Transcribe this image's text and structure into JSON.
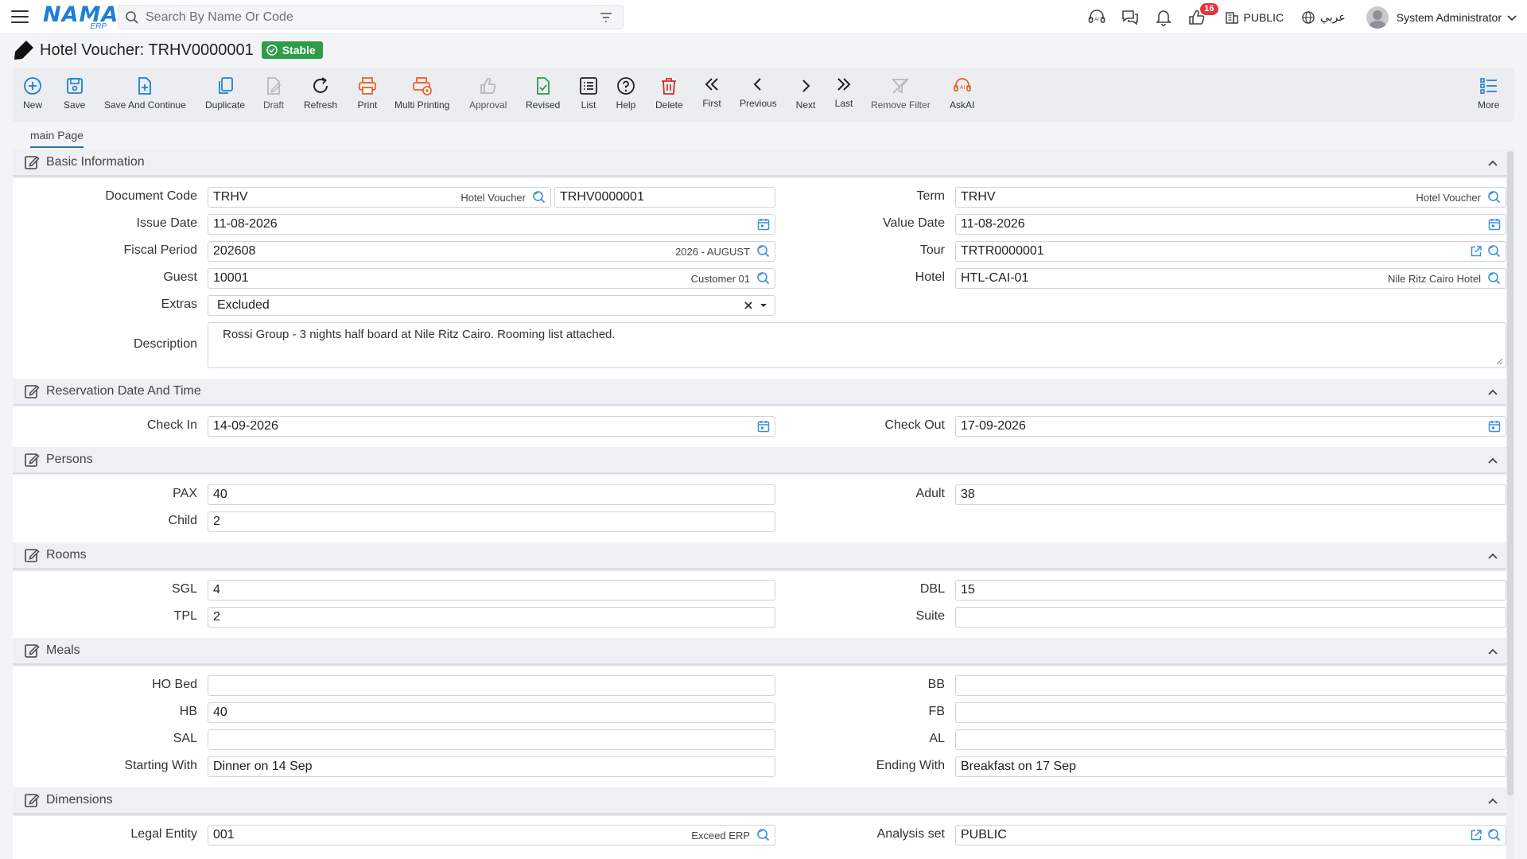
{
  "app": {
    "logo": "NAMA",
    "logo_sub": "ERP",
    "search_placeholder": "Search By Name Or Code",
    "notifications_count": "16",
    "branch": "PUBLIC",
    "language": "عربي",
    "user": "System Administrator"
  },
  "page": {
    "title": "Hotel Voucher: TRHV0000001",
    "status": "Stable"
  },
  "toolbar": {
    "new": "New",
    "save": "Save",
    "save_continue": "Save And Continue",
    "duplicate": "Duplicate",
    "draft": "Draft",
    "refresh": "Refresh",
    "print": "Print",
    "multi_printing": "Multi Printing",
    "approval": "Approval",
    "revised": "Revised",
    "list": "List",
    "help": "Help",
    "delete": "Delete",
    "first": "First",
    "previous": "Previous",
    "next": "Next",
    "last": "Last",
    "remove_filter": "Remove Filter",
    "askai": "AskAI",
    "more": "More"
  },
  "tabs": {
    "main": "main Page"
  },
  "colors": {
    "accent": "#1f7ed6",
    "success": "#2e9c49",
    "danger": "#e5343d",
    "orange": "#e8632b"
  },
  "sections": {
    "basic": {
      "title": "Basic Information",
      "document_code": {
        "label": "Document Code",
        "value": "TRHV",
        "sub": "Hotel Voucher",
        "code": "TRHV0000001"
      },
      "term": {
        "label": "Term",
        "value": "TRHV",
        "sub": "Hotel Voucher"
      },
      "issue_date": {
        "label": "Issue Date",
        "value": "11-08-2026"
      },
      "value_date": {
        "label": "Value Date",
        "value": "11-08-2026"
      },
      "fiscal_period": {
        "label": "Fiscal Period",
        "value": "202608",
        "sub": "2026 - AUGUST"
      },
      "tour": {
        "label": "Tour",
        "value": "TRTR0000001"
      },
      "guest": {
        "label": "Guest",
        "value": "10001",
        "sub": "Customer 01"
      },
      "hotel": {
        "label": "Hotel",
        "value": "HTL-CAI-01",
        "sub": "Nile Ritz Cairo Hotel"
      },
      "extras": {
        "label": "Extras",
        "value": "Excluded"
      },
      "description": {
        "label": "Description",
        "value": "Rossi Group - 3 nights half board at Nile Ritz Cairo. Rooming list attached."
      }
    },
    "reservation": {
      "title": "Reservation Date And Time",
      "check_in": {
        "label": "Check In",
        "value": "14-09-2026"
      },
      "check_out": {
        "label": "Check Out",
        "value": "17-09-2026"
      }
    },
    "persons": {
      "title": "Persons",
      "pax": {
        "label": "PAX",
        "value": "40"
      },
      "adult": {
        "label": "Adult",
        "value": "38"
      },
      "child": {
        "label": "Child",
        "value": "2"
      }
    },
    "rooms": {
      "title": "Rooms",
      "sgl": {
        "label": "SGL",
        "value": "4"
      },
      "dbl": {
        "label": "DBL",
        "value": "15"
      },
      "tpl": {
        "label": "TPL",
        "value": "2"
      },
      "suite": {
        "label": "Suite",
        "value": ""
      }
    },
    "meals": {
      "title": "Meals",
      "ho_bed": {
        "label": "HO Bed",
        "value": ""
      },
      "bb": {
        "label": "BB",
        "value": ""
      },
      "hb": {
        "label": "HB",
        "value": "40"
      },
      "fb": {
        "label": "FB",
        "value": ""
      },
      "sal": {
        "label": "SAL",
        "value": ""
      },
      "al": {
        "label": "AL",
        "value": ""
      },
      "starting_with": {
        "label": "Starting With",
        "value": "Dinner on 14 Sep"
      },
      "ending_with": {
        "label": "Ending With",
        "value": "Breakfast on 17 Sep"
      }
    },
    "dimensions": {
      "title": "Dimensions",
      "legal_entity": {
        "label": "Legal Entity",
        "value": "001",
        "sub": "Exceed ERP"
      },
      "analysis_set": {
        "label": "Analysis set",
        "value": "PUBLIC"
      }
    }
  }
}
